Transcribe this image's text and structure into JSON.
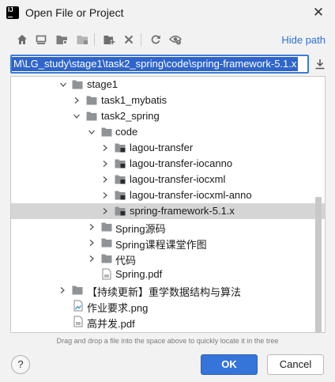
{
  "window": {
    "title": "Open File or Project"
  },
  "toolbar": {
    "buttons": [
      "home-icon",
      "desktop-icon",
      "project-folder-icon",
      "module-folder-icon",
      "new-folder-icon",
      "delete-icon",
      "refresh-icon",
      "show-hidden-icon"
    ],
    "hide_path_label": "Hide path"
  },
  "path": {
    "value": "M\\LG_study\\stage1\\task2_spring\\code\\spring-framework-5.1.x"
  },
  "tree": {
    "items": [
      {
        "label": "stage1",
        "type": "folder",
        "expanded": true,
        "depth": 0
      },
      {
        "label": "task1_mybatis",
        "type": "folder",
        "expanded": false,
        "depth": 1
      },
      {
        "label": "task2_spring",
        "type": "folder",
        "expanded": true,
        "depth": 1
      },
      {
        "label": "code",
        "type": "folder",
        "expanded": true,
        "depth": 2
      },
      {
        "label": "lagou-transfer",
        "type": "module",
        "expanded": false,
        "depth": 3
      },
      {
        "label": "lagou-transfer-iocanno",
        "type": "module",
        "expanded": false,
        "depth": 3
      },
      {
        "label": "lagou-transfer-iocxml",
        "type": "module",
        "expanded": false,
        "depth": 3
      },
      {
        "label": "lagou-transfer-iocxml-anno",
        "type": "module",
        "expanded": false,
        "depth": 3
      },
      {
        "label": "spring-framework-5.1.x",
        "type": "module",
        "expanded": false,
        "depth": 3,
        "selected": true
      },
      {
        "label": "Spring源码",
        "type": "folder",
        "expanded": false,
        "depth": 2
      },
      {
        "label": "Spring课程课堂作图",
        "type": "folder",
        "expanded": false,
        "depth": 2
      },
      {
        "label": "代码",
        "type": "folder",
        "expanded": false,
        "depth": 2
      },
      {
        "label": "Spring.pdf",
        "type": "pdf",
        "depth": 2
      },
      {
        "label": "【持续更新】重学数据结构与算法",
        "type": "folder",
        "expanded": false,
        "depth": 0
      },
      {
        "label": "作业要求.png",
        "type": "image",
        "depth": 0
      },
      {
        "label": "高并发.pdf",
        "type": "pdf",
        "depth": 0
      }
    ]
  },
  "hint": "Drag and drop a file into the space above to quickly locate it in the tree",
  "buttons": {
    "help": "?",
    "ok": "OK",
    "cancel": "Cancel"
  },
  "colors": {
    "accent": "#3574d9",
    "link": "#2f6ed9",
    "selection": "#d5d5d5",
    "folder": "#8f9396"
  }
}
